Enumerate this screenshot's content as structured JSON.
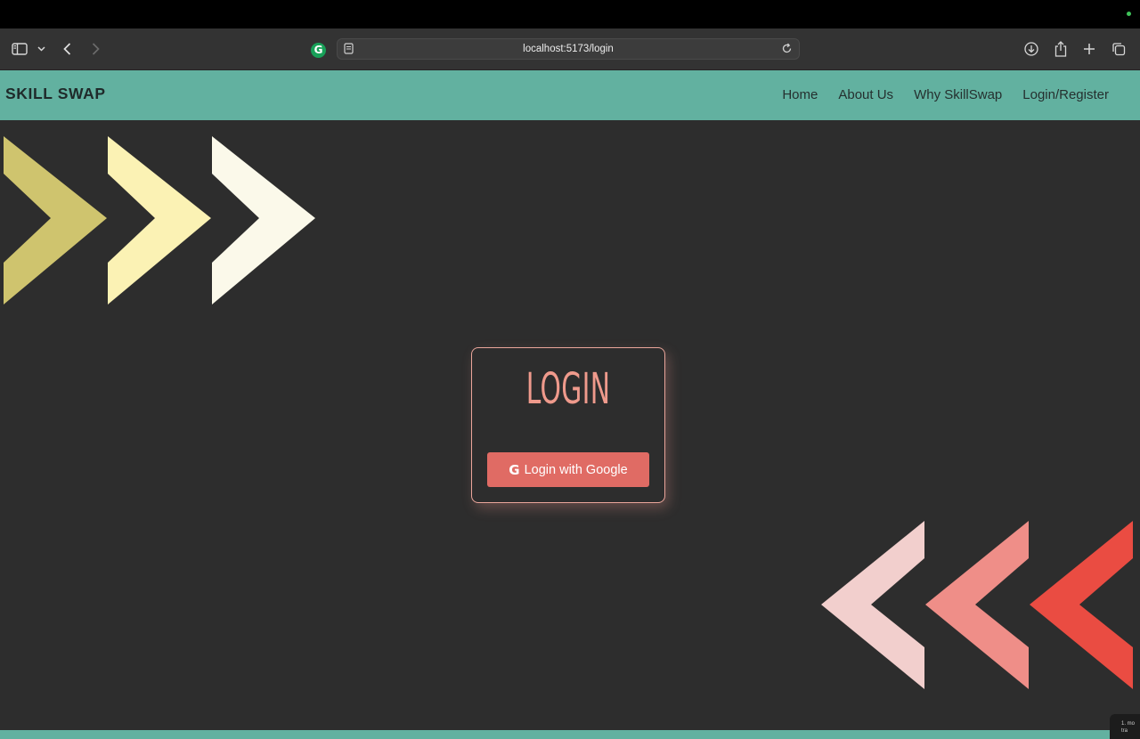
{
  "browser": {
    "url": "localhost:5173/login",
    "extension_icon_letter": "G"
  },
  "navbar": {
    "brand": "SKILL SWAP",
    "links": [
      {
        "label": "Home"
      },
      {
        "label": "About Us"
      },
      {
        "label": "Why SkillSwap"
      },
      {
        "label": "Login/Register"
      }
    ],
    "color": "#62b1a0"
  },
  "login": {
    "title": "LOGIN",
    "google_button_icon": "G",
    "google_button_label": "Login with Google",
    "accent_color": "#ef9a8c",
    "button_color": "#e06b64"
  },
  "decor": {
    "right_chevron_colors": [
      "#cfc46e",
      "#fbf2b4",
      "#fbf9ea"
    ],
    "left_chevron_colors": [
      "#f2cfcd",
      "#ef8e88",
      "#ea4c42"
    ]
  },
  "corner_widget": {
    "text": "1. mo tra"
  }
}
